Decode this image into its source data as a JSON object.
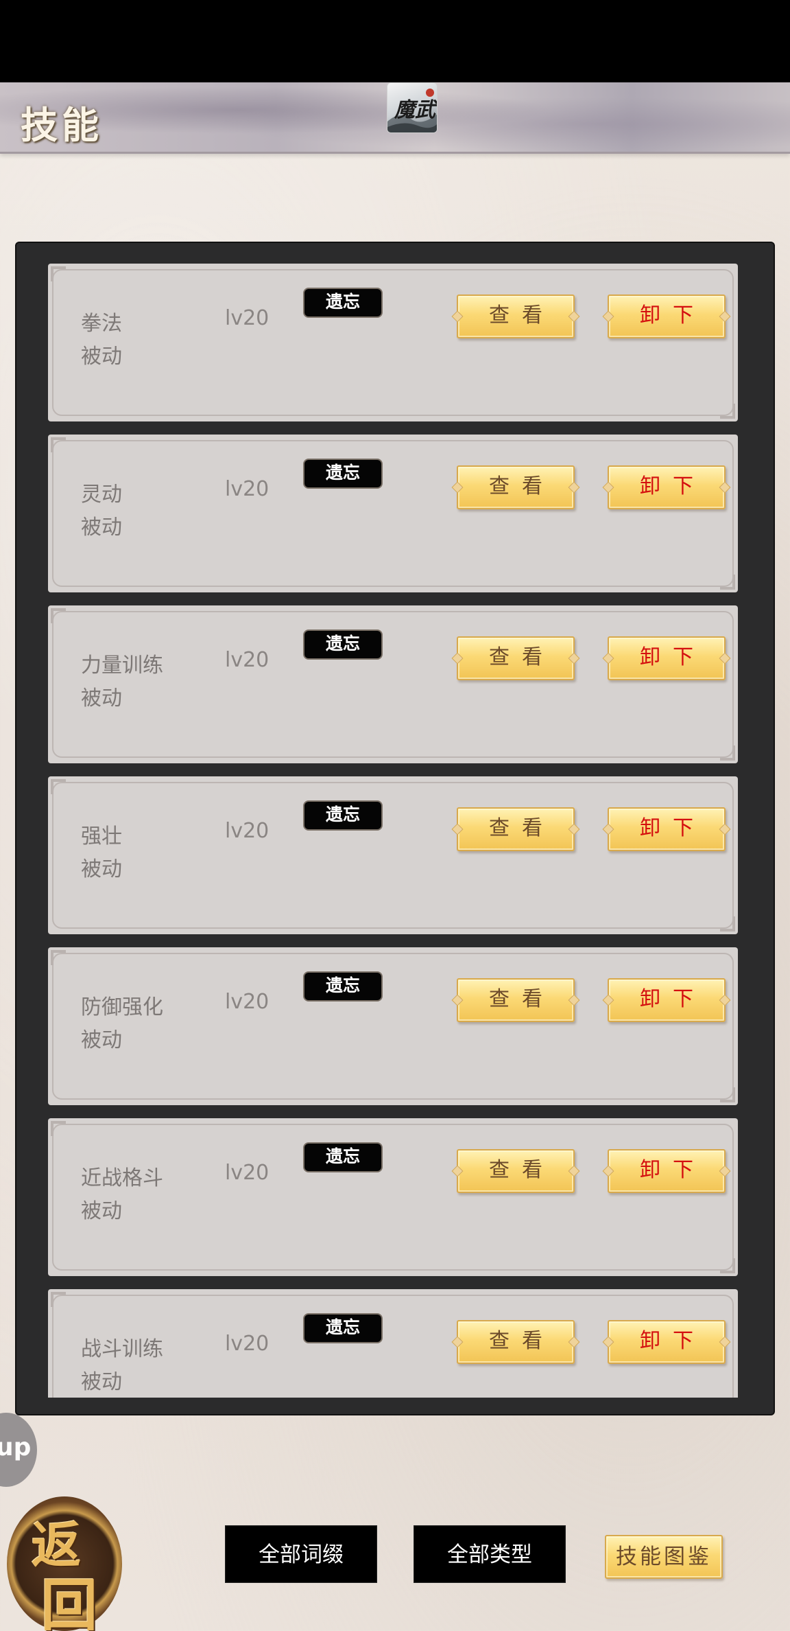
{
  "header": {
    "title": "技能",
    "logo_text": "魔武"
  },
  "skills": [
    {
      "name": "拳法",
      "type": "被动",
      "level": "lv20",
      "forget_label": "遗忘",
      "view_label": "查看",
      "unequip_label": "卸下"
    },
    {
      "name": "灵动",
      "type": "被动",
      "level": "lv20",
      "forget_label": "遗忘",
      "view_label": "查看",
      "unequip_label": "卸下"
    },
    {
      "name": "力量训练",
      "type": "被动",
      "level": "lv20",
      "forget_label": "遗忘",
      "view_label": "查看",
      "unequip_label": "卸下"
    },
    {
      "name": "强壮",
      "type": "被动",
      "level": "lv20",
      "forget_label": "遗忘",
      "view_label": "查看",
      "unequip_label": "卸下"
    },
    {
      "name": "防御强化",
      "type": "被动",
      "level": "lv20",
      "forget_label": "遗忘",
      "view_label": "查看",
      "unequip_label": "卸下"
    },
    {
      "name": "近战格斗",
      "type": "被动",
      "level": "lv20",
      "forget_label": "遗忘",
      "view_label": "查看",
      "unequip_label": "卸下"
    },
    {
      "name": "战斗训练",
      "type": "被动",
      "level": "lv20",
      "forget_label": "遗忘",
      "view_label": "查看",
      "unequip_label": "卸下"
    }
  ],
  "help": {
    "label": "up"
  },
  "return_button": {
    "glyph_top": "返",
    "glyph_bottom": "回"
  },
  "footer": {
    "all_affix_label": "全部词缀",
    "all_type_label": "全部类型",
    "skill_codex_label": "技能图鉴"
  },
  "colors": {
    "gold_button": "#fbd975",
    "unequip_text": "#d40f0f",
    "panel_bg": "#2b2b2c",
    "card_bg": "#d6d2d0"
  }
}
